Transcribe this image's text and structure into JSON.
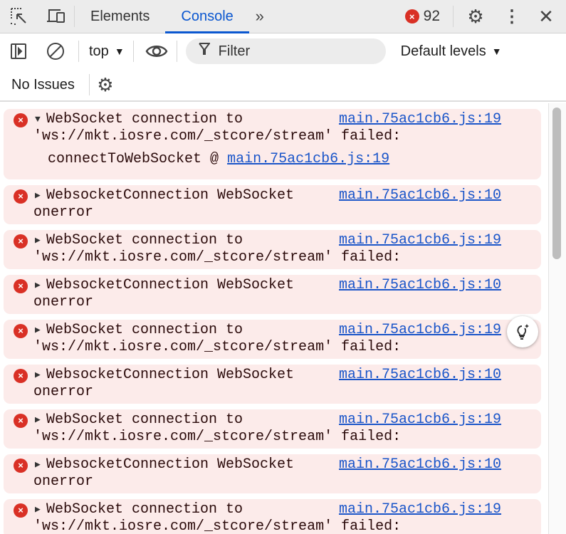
{
  "tabs": {
    "elements": "Elements",
    "console": "Console"
  },
  "error_count": "92",
  "toolbar": {
    "context": "top",
    "filter_placeholder": "Filter",
    "levels": "Default levels"
  },
  "issues": {
    "label": "No Issues"
  },
  "colors": {
    "accent": "#0b57d0",
    "error": "#d93025",
    "row_bg": "#fcebea",
    "link": "#1a55c9"
  },
  "messages": [
    {
      "expanded": true,
      "line1": "WebSocket connection to",
      "line2": "'ws://mkt.iosre.com/_stcore/stream' failed:",
      "source": "main.75ac1cb6.js:19",
      "stack_fn": "connectToWebSocket @",
      "stack_link": "main.75ac1cb6.js:19"
    },
    {
      "expanded": false,
      "line1": "WebsocketConnection WebSocket",
      "line2": "onerror",
      "source": "main.75ac1cb6.js:10"
    },
    {
      "expanded": false,
      "line1": "WebSocket connection to",
      "line2": "'ws://mkt.iosre.com/_stcore/stream' failed:",
      "source": "main.75ac1cb6.js:19"
    },
    {
      "expanded": false,
      "line1": "WebsocketConnection WebSocket",
      "line2": "onerror",
      "source": "main.75ac1cb6.js:10"
    },
    {
      "expanded": false,
      "line1": "WebSocket connection to",
      "line2": "'ws://mkt.iosre.com/_stcore/stream' failed:",
      "source": "main.75ac1cb6.js:19"
    },
    {
      "expanded": false,
      "line1": "WebsocketConnection WebSocket",
      "line2": "onerror",
      "source": "main.75ac1cb6.js:10"
    },
    {
      "expanded": false,
      "line1": "WebSocket connection to",
      "line2": "'ws://mkt.iosre.com/_stcore/stream' failed:",
      "source": "main.75ac1cb6.js:19"
    },
    {
      "expanded": false,
      "line1": "WebsocketConnection WebSocket",
      "line2": "onerror",
      "source": "main.75ac1cb6.js:10"
    },
    {
      "expanded": false,
      "line1": "WebSocket connection to",
      "line2": "'ws://mkt.iosre.com/_stcore/stream' failed:",
      "source": "main.75ac1cb6.js:19"
    }
  ]
}
